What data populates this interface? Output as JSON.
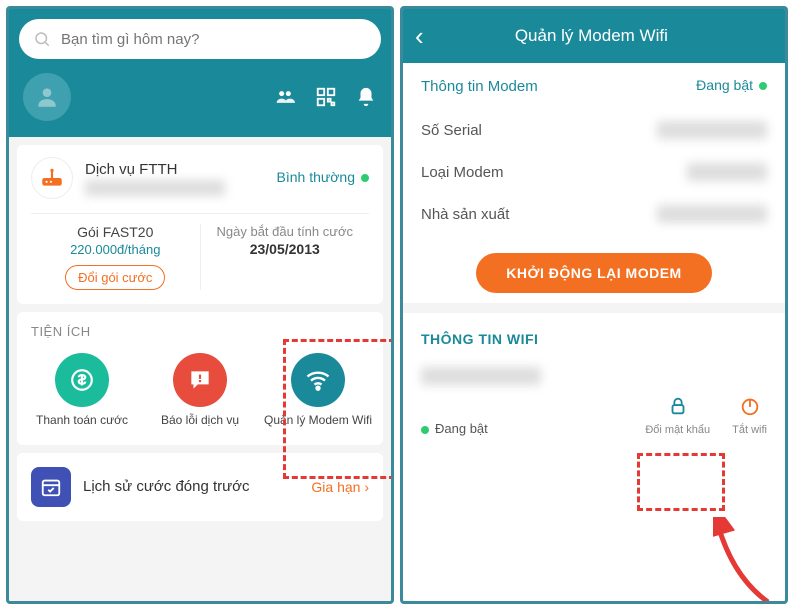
{
  "left": {
    "search_placeholder": "Bạn tìm gì hôm nay?",
    "service_title": "Dịch vụ FTTH",
    "service_status": "Bình thường",
    "plan_name": "Gói FAST20",
    "plan_price": "220.000đ/tháng",
    "change_plan": "Đổi gói cước",
    "billing_start_label": "Ngày bắt đầu tính cước",
    "billing_start_date": "23/05/2013",
    "utilities_title": "TIỆN ÍCH",
    "utilities": [
      {
        "label": "Thanh toán cước"
      },
      {
        "label": "Báo lỗi dịch vụ"
      },
      {
        "label": "Quản lý Modem Wifi"
      }
    ],
    "history_label": "Lịch sử cước đóng trước",
    "renew": "Gia hạn"
  },
  "right": {
    "title": "Quản lý Modem Wifi",
    "modem_info_title": "Thông tin Modem",
    "modem_status": "Đang bật",
    "rows": {
      "serial": "Số Serial",
      "type": "Loại Modem",
      "manufacturer": "Nhà sản xuất"
    },
    "restart_btn": "KHỞI ĐỘNG LẠI MODEM",
    "wifi_info_title": "THÔNG TIN WIFI",
    "wifi_status": "Đang bật",
    "change_pw": "Đổi mật khẩu",
    "turn_off": "Tắt wifi"
  }
}
